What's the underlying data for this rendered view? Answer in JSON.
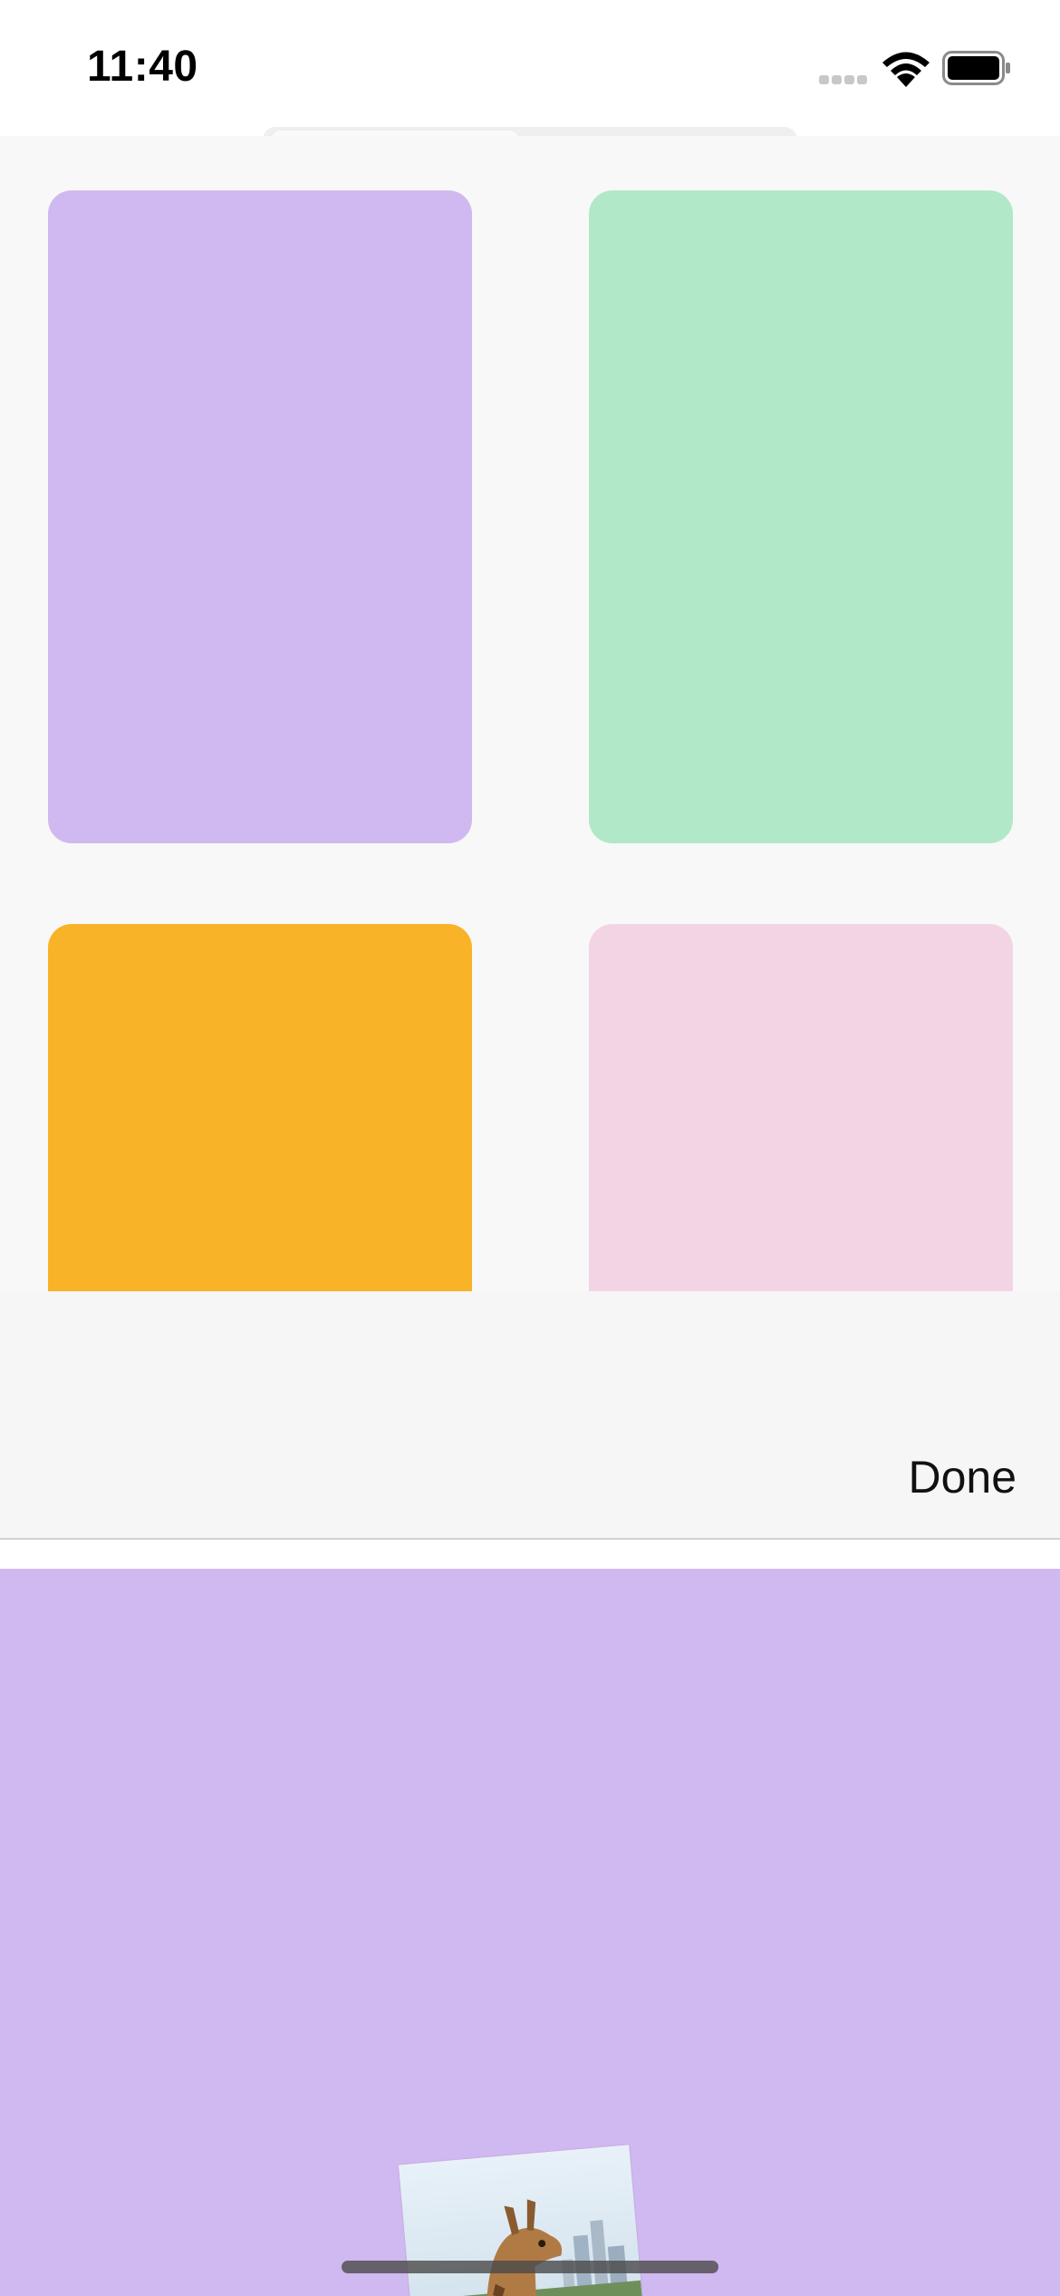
{
  "status_bar": {
    "time": "11:40",
    "signal_icon": "cellular-signal-icon",
    "wifi_icon": "wifi-icon",
    "battery_icon": "battery-icon"
  },
  "gallery": {
    "swatches": [
      {
        "color": "#d0b8f0"
      },
      {
        "color": "#b1e8c8"
      },
      {
        "color": "#f9b329"
      },
      {
        "color": "#f2d4e5"
      }
    ]
  },
  "toolbar": {
    "done_label": "Done"
  },
  "preview": {
    "background_color": "#d0b8f0",
    "sticker_image": "giraffe-photo"
  }
}
